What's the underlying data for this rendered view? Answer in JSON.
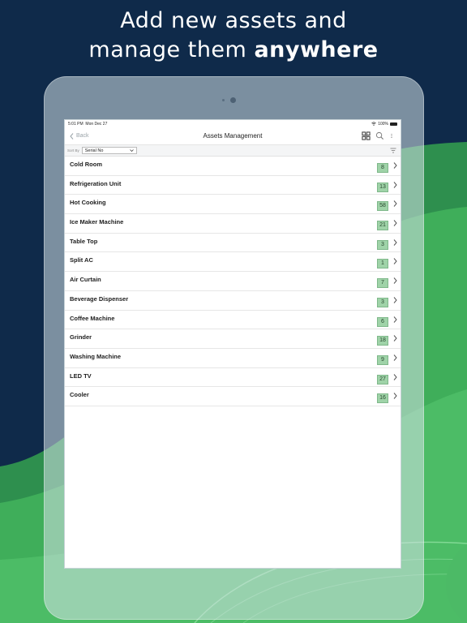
{
  "headline": {
    "line1": "Add new assets and",
    "line2_regular": "manage them",
    "line2_bold": "anywhere"
  },
  "status": {
    "time": "5:01 PM",
    "date": "Mon Dec 27",
    "battery": "100%"
  },
  "nav": {
    "back_label": "Back",
    "title": "Assets Management"
  },
  "sort": {
    "label": "Sort By",
    "selected": "Serial No"
  },
  "colors": {
    "background": "#0f2a4a",
    "accent_green": "#3fae5a",
    "badge": "#9fd3a8"
  },
  "assets": [
    {
      "name": "Cold Room",
      "count": "8"
    },
    {
      "name": "Refrigeration Unit",
      "count": "13"
    },
    {
      "name": "Hot Cooking",
      "count": "58"
    },
    {
      "name": "Ice Maker Machine",
      "count": "21"
    },
    {
      "name": "Table Top",
      "count": "3"
    },
    {
      "name": "Split AC",
      "count": "1"
    },
    {
      "name": "Air Curtain",
      "count": "7"
    },
    {
      "name": "Beverage Dispenser",
      "count": "3"
    },
    {
      "name": "Coffee Machine",
      "count": "6"
    },
    {
      "name": "Grinder",
      "count": "18"
    },
    {
      "name": "Washing Machine",
      "count": "9"
    },
    {
      "name": "LED TV",
      "count": "27"
    },
    {
      "name": "Cooler",
      "count": "16"
    }
  ]
}
